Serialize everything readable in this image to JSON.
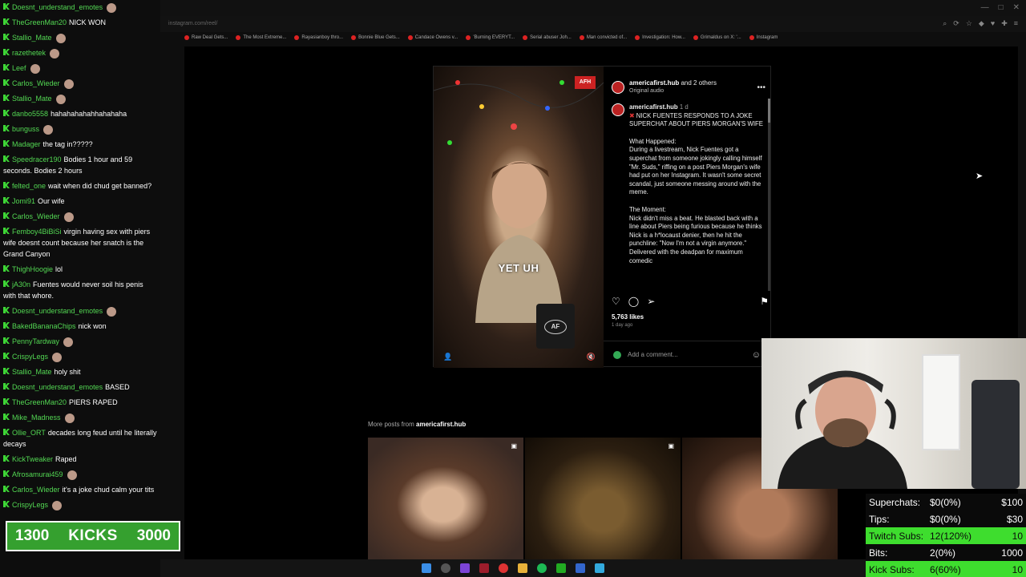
{
  "chat": {
    "messages": [
      {
        "user": "Doesnt_understand_emotes",
        "text": ""
      },
      {
        "user": "TheGreenMan20",
        "text": "NICK WON"
      },
      {
        "user": "Stallio_Mate",
        "text": ""
      },
      {
        "user": "razethetek",
        "text": ""
      },
      {
        "user": "Leef",
        "text": ""
      },
      {
        "user": "Carlos_Wieder",
        "text": ""
      },
      {
        "user": "Stallio_Mate",
        "text": ""
      },
      {
        "user": "danbo5558",
        "text": "hahahahahahhahahaha"
      },
      {
        "user": "bunguss",
        "text": ""
      },
      {
        "user": "Madager",
        "text": "the tag in?????"
      },
      {
        "user": "Speedracer190",
        "text": "Bodies 1 hour and 59 seconds. Bodies 2 hours"
      },
      {
        "user": "felted_one",
        "text": "wait when did chud get banned?"
      },
      {
        "user": "Jomi91",
        "text": "Our wife"
      },
      {
        "user": "Carlos_Wieder",
        "text": ""
      },
      {
        "user": "Femboy4BiBiSi",
        "text": "virgin having sex with piers wife doesnt count because her snatch is the Grand Canyon"
      },
      {
        "user": "ThighHoogie",
        "text": "lol"
      },
      {
        "user": "jA30n",
        "text": "Fuentes would never soil his penis with that whore."
      },
      {
        "user": "Doesnt_understand_emotes",
        "text": ""
      },
      {
        "user": "BakedBananaChips",
        "text": "nick won"
      },
      {
        "user": "PennyTardway",
        "text": ""
      },
      {
        "user": "CrispyLegs",
        "text": ""
      },
      {
        "user": "Stallio_Mate",
        "text": "holy shit"
      },
      {
        "user": "Doesnt_understand_emotes",
        "text": "BASED"
      },
      {
        "user": "TheGreenMan20",
        "text": "PIERS RAPED"
      },
      {
        "user": "Mike_Madness",
        "text": ""
      },
      {
        "user": "Ollie_ORT",
        "text": "decades long feud until he literally decays"
      },
      {
        "user": "KickTweaker",
        "text": "Raped"
      },
      {
        "user": "Afrosamurai459",
        "text": ""
      },
      {
        "user": "Carlos_Wieder",
        "text": "it's a joke chud calm your tits"
      },
      {
        "user": "CrispyLegs",
        "text": ""
      }
    ]
  },
  "kicks": {
    "current": "1300",
    "label": "KICKS",
    "goal": "3000"
  },
  "browser": {
    "address": "instagram.com/reel/",
    "bookmarks": [
      "Raw Deal Gets...",
      "The Most Extreme...",
      "Rayasianboy thro...",
      "Bonnie Blue Gets...",
      "Candace Owens v...",
      "'Burning EVERYT...",
      "Serial abuser Joh...",
      "Man convicted of...",
      "Investigation: How...",
      "Grimaldus on X: '...",
      "Instagram"
    ]
  },
  "post": {
    "account": "americafirst.hub",
    "collab": "and 2 others",
    "audio": "Original audio",
    "comment_user": "americafirst.hub",
    "comment_age": "1 d",
    "headline": "NICK FUENTES RESPONDS TO A JOKE SUPERCHAT ABOUT PIERS MORGAN'S WIFE",
    "what_happened_title": "What Happened:",
    "what_happened": "During a livestream, Nick Fuentes got a superchat from someone jokingly calling himself \"Mr. Suds,\" riffing on a post Piers Morgan's wife had put on her Instagram. It wasn't some secret scandal, just someone messing around with the meme.",
    "moment_title": "The Moment:",
    "moment": "Nick didn't miss a beat. He blasted back with a line about Piers being furious because he thinks Nick is a h*locaust denier, then he hit the punchline: \"Now I'm not a virgin anymore.\" Delivered with the deadpan for maximum comedic",
    "video_caption": "YET UH",
    "likes": "5,763 likes",
    "posted": "1 day ago",
    "add_comment_placeholder": "Add a comment...",
    "more_posts_prefix": "More posts from",
    "more_posts_account": "americafirst.hub"
  },
  "goals": [
    {
      "label": "Superchats:",
      "value": "$0(0%)",
      "target": "$100",
      "highlight": false
    },
    {
      "label": "Tips:",
      "value": "$0(0%)",
      "target": "$30",
      "highlight": false
    },
    {
      "label": "Twitch Subs:",
      "value": "12(120%)",
      "target": "10",
      "highlight": true
    },
    {
      "label": "Bits:",
      "value": "2(0%)",
      "target": "1000",
      "highlight": false
    },
    {
      "label": "Kick Subs:",
      "value": "6(60%)",
      "target": "10",
      "highlight": true
    }
  ],
  "colors": {
    "kick_green": "#3edd2e",
    "chat_user": "#53d853",
    "instagram_bg": "#000000"
  }
}
